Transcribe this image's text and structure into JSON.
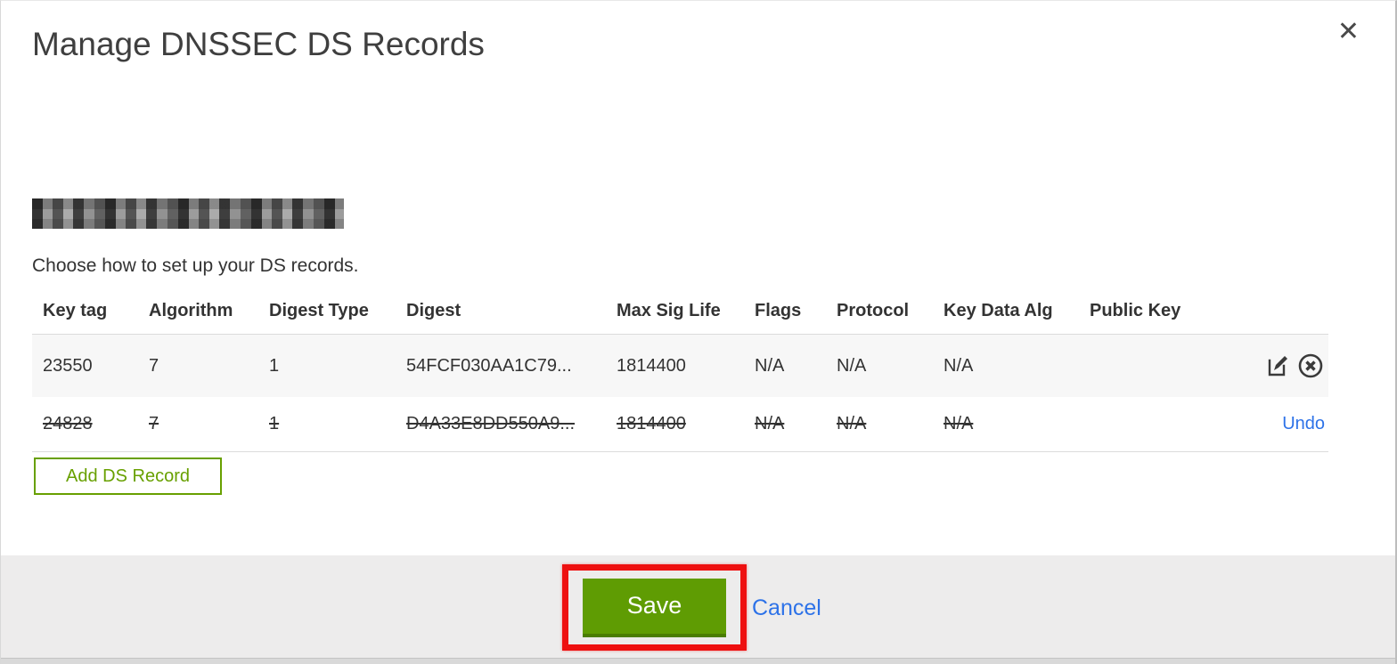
{
  "modal": {
    "title": "Manage DNSSEC DS Records",
    "close_icon": "close-icon",
    "domain": {
      "redacted": true
    },
    "instruction": "Choose how to set up your DS records.",
    "table": {
      "columns": [
        "Key tag",
        "Algorithm",
        "Digest Type",
        "Digest",
        "Max Sig Life",
        "Flags",
        "Protocol",
        "Key Data Alg",
        "Public Key"
      ],
      "rows": [
        {
          "key_tag": "23550",
          "algorithm": "7",
          "digest_type": "1",
          "digest": "54FCF030AA1C79...",
          "max_sig_life": "1814400",
          "flags": "N/A",
          "protocol": "N/A",
          "key_data_alg": "N/A",
          "public_key": "",
          "state": "normal",
          "actions": [
            "edit",
            "delete"
          ]
        },
        {
          "key_tag": "24828",
          "algorithm": "7",
          "digest_type": "1",
          "digest": "D4A33E8DD550A9...",
          "max_sig_life": "1814400",
          "flags": "N/A",
          "protocol": "N/A",
          "key_data_alg": "N/A",
          "public_key": "",
          "state": "deleted",
          "undo_label": "Undo"
        }
      ]
    },
    "add_button_label": "Add DS Record",
    "footer": {
      "save_label": "Save",
      "cancel_label": "Cancel"
    }
  },
  "annotation": {
    "type": "red-highlight-box",
    "target": "save-button",
    "color": "#ee1010"
  },
  "colors": {
    "green_button": "#5f9c03",
    "green_outline": "#68a000",
    "link_blue": "#2d72e8",
    "footer_gray": "#edecec",
    "row_alt_gray": "#f7f7f7"
  }
}
